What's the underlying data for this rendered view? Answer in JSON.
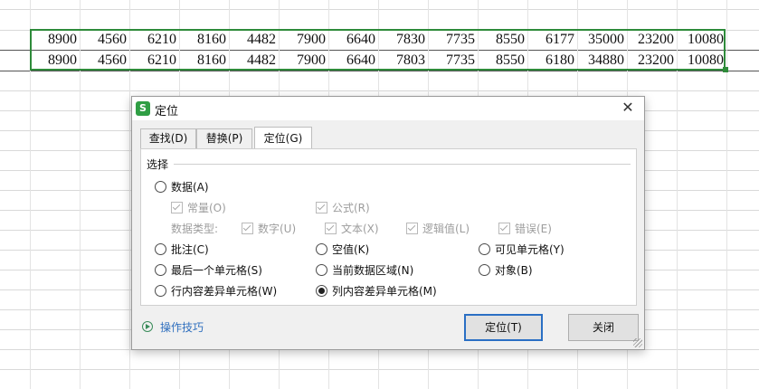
{
  "sheet": {
    "rows": [
      [
        "8900",
        "4560",
        "6210",
        "8160",
        "4482",
        "7900",
        "6640",
        "7830",
        "7735",
        "8550",
        "6177",
        "35000",
        "23200",
        "10080"
      ],
      [
        "8900",
        "4560",
        "6210",
        "8160",
        "4482",
        "7900",
        "6640",
        "7803",
        "7735",
        "8550",
        "6180",
        "34880",
        "23200",
        "10080"
      ]
    ],
    "selection_color": "#2e8b3a"
  },
  "dialog": {
    "title": "定位",
    "app_icon_letter": "S",
    "tabs": [
      {
        "label": "查找(D)"
      },
      {
        "label": "替换(P)"
      },
      {
        "label": "定位(G)",
        "active": true
      }
    ],
    "group_label": "选择",
    "options": {
      "data": "数据(A)",
      "constant": "常量(O)",
      "formula": "公式(R)",
      "data_type_label": "数据类型:",
      "number": "数字(U)",
      "text": "文本(X)",
      "logical": "逻辑值(L)",
      "error": "错误(E)",
      "comment": "批注(C)",
      "blank": "空值(K)",
      "visible_cells": "可见单元格(Y)",
      "last_cell": "最后一个单元格(S)",
      "current_region": "当前数据区域(N)",
      "objects": "对象(B)",
      "row_diff": "行内容差异单元格(W)",
      "col_diff": "列内容差异单元格(M)"
    },
    "selected_option": "col_diff",
    "tips_link": "操作技巧",
    "locate_button": "定位(T)",
    "close_button": "关闭"
  }
}
